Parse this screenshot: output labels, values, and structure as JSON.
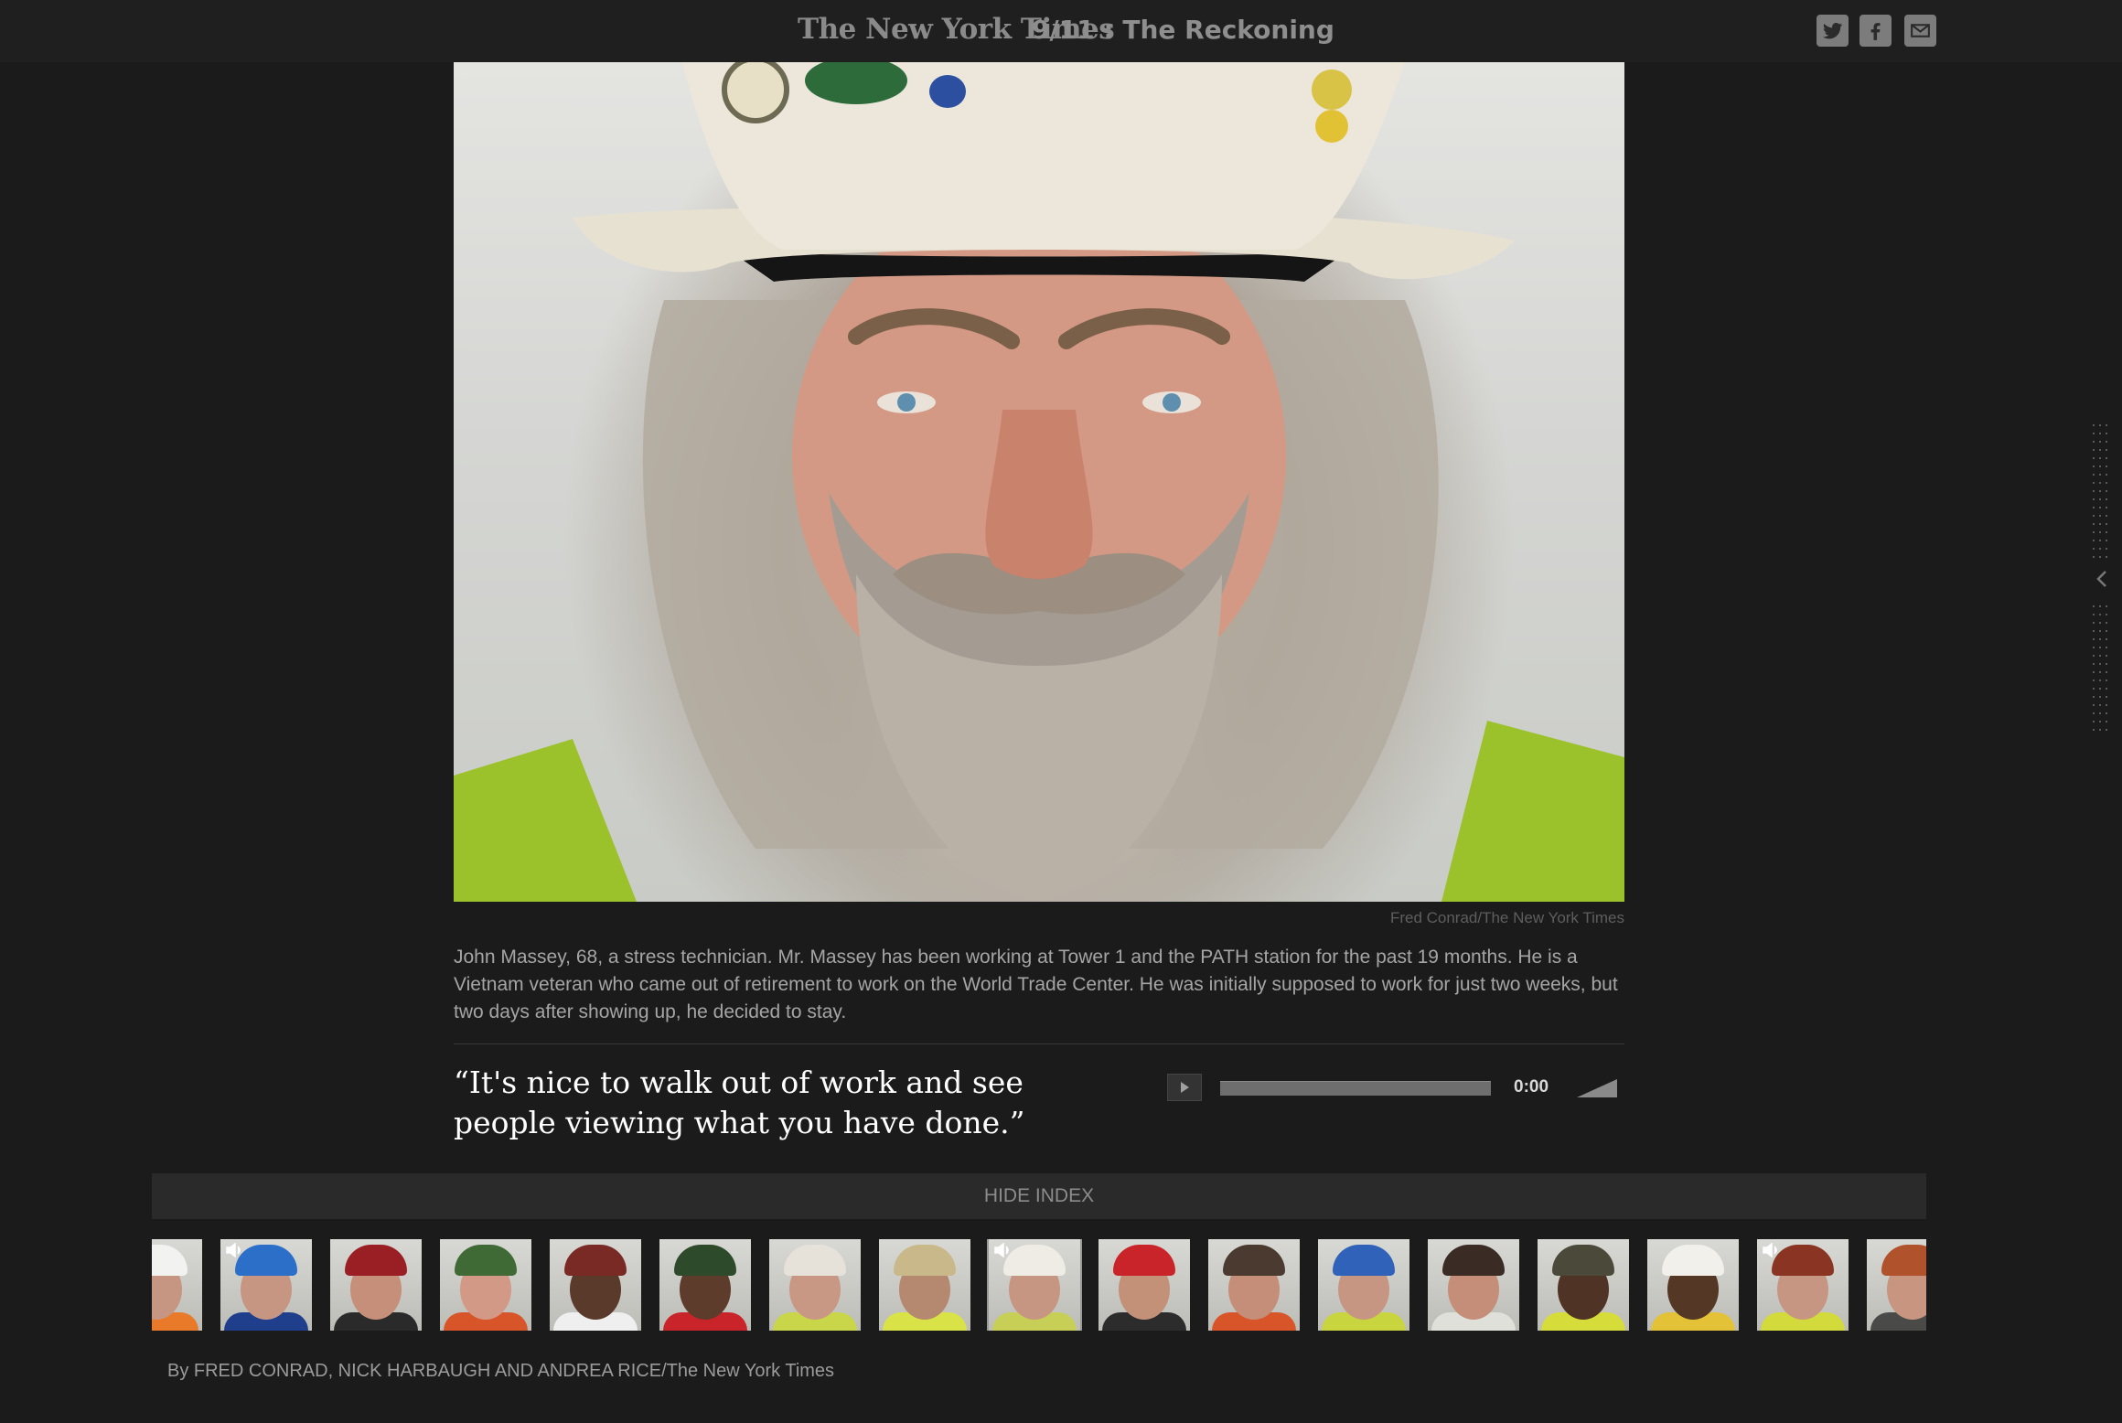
{
  "header": {
    "brand": "The New York Times",
    "title": "9/11 : The Reckoning",
    "social": [
      {
        "name": "twitter-icon",
        "glyph": "twitter"
      },
      {
        "name": "facebook-icon",
        "glyph": "facebook"
      },
      {
        "name": "email-icon",
        "glyph": "email"
      }
    ]
  },
  "photo": {
    "credit": "Fred Conrad/The New York Times",
    "caption": "John Massey, 68, a stress technician. Mr. Massey has been working at Tower 1 and the PATH station for the past 19 months. He is a Vietnam veteran who came out of retirement to work on the World Trade Center. He was initially supposed to work for just two weeks, but two days after showing up, he decided to stay."
  },
  "quote": "“It's nice to walk out of work and see people viewing what you have done.”",
  "audio": {
    "time": "0:00",
    "progress": 0
  },
  "index": {
    "toggle_label": "HIDE INDEX",
    "thumbnails": [
      {
        "hat": "#f2f2f0",
        "shirt": "#e87a2a",
        "face": "#c79683",
        "audio": false,
        "current": false
      },
      {
        "hat": "#2b6fc9",
        "shirt": "#1f3f8c",
        "face": "#c79683",
        "audio": true,
        "current": false
      },
      {
        "hat": "#9a1f25",
        "shirt": "#2a2a2a",
        "face": "#c58f79",
        "audio": false,
        "current": false
      },
      {
        "hat": "#3f6a35",
        "shirt": "#d8552a",
        "face": "#d29a86",
        "audio": false,
        "current": false
      },
      {
        "hat": "#7a2a25",
        "shirt": "#efefef",
        "face": "#5a3a2a",
        "audio": false,
        "current": false
      },
      {
        "hat": "#2d4a2a",
        "shirt": "#c8242a",
        "face": "#5e3c2b",
        "audio": false,
        "current": false
      },
      {
        "hat": "#e6e2da",
        "shirt": "#c9d64a",
        "face": "#c99884",
        "audio": false,
        "current": false
      },
      {
        "hat": "#c9b88a",
        "shirt": "#d9e246",
        "face": "#b58870",
        "audio": false,
        "current": false
      },
      {
        "hat": "#efece5",
        "shirt": "#c8cf56",
        "face": "#c79683",
        "audio": true,
        "current": true
      },
      {
        "hat": "#c8242a",
        "shirt": "#2c2c2c",
        "face": "#c39078",
        "audio": false,
        "current": false
      },
      {
        "hat": "#4a3a30",
        "shirt": "#d8552a",
        "face": "#c48e79",
        "audio": false,
        "current": false
      },
      {
        "hat": "#2f62b8",
        "shirt": "#c9d53e",
        "face": "#c79683",
        "audio": false,
        "current": false
      },
      {
        "hat": "#3a2c24",
        "shirt": "#e0e0da",
        "face": "#c48e79",
        "audio": false,
        "current": false
      },
      {
        "hat": "#4b4a3a",
        "shirt": "#d6dd3a",
        "face": "#4f3425",
        "audio": false,
        "current": false
      },
      {
        "hat": "#f1f0ea",
        "shirt": "#e3c237",
        "face": "#553726",
        "audio": false,
        "current": false
      },
      {
        "hat": "#8a3424",
        "shirt": "#d3da3c",
        "face": "#c79683",
        "audio": true,
        "current": false
      },
      {
        "hat": "#b0532c",
        "shirt": "#4a4a48",
        "face": "#c89580",
        "audio": false,
        "current": false
      }
    ]
  },
  "byline": "By FRED CONRAD, NICK HARBAUGH AND ANDREA RICE/The New York Times",
  "colors": {
    "background": "#1b1b1b",
    "quote_text": "#ffffff",
    "caption_text": "#a5a5a5",
    "icon_fill": "#7c7c7c"
  }
}
